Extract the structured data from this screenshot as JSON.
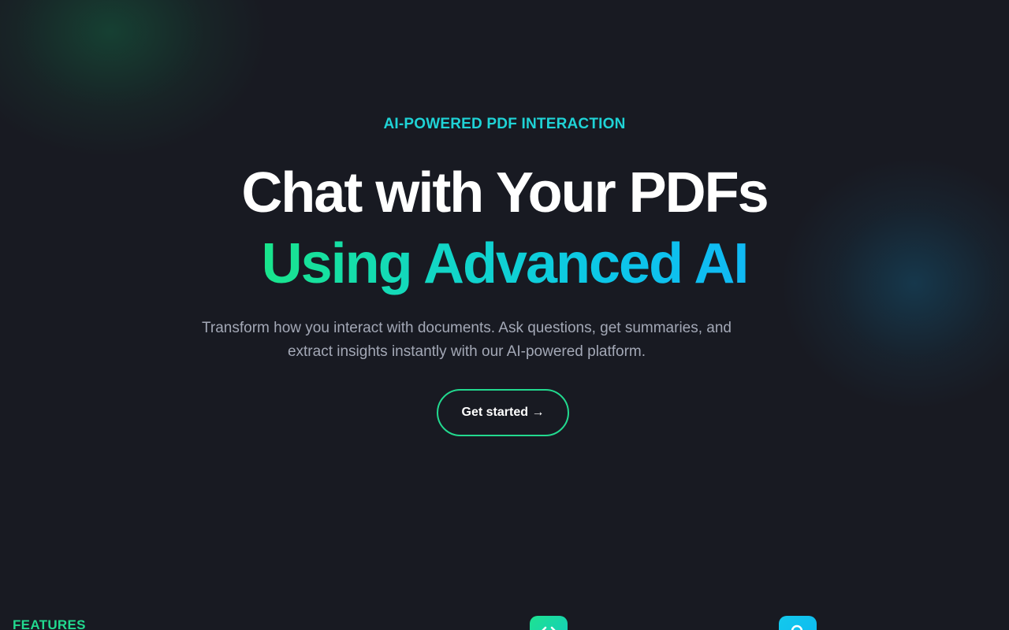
{
  "hero": {
    "eyebrow": "AI-POWERED PDF INTERACTION",
    "title_line1": "Chat with Your PDFs",
    "title_line2": "Using Advanced AI",
    "subtitle": "Transform how you interact with documents. Ask questions, get summaries, and extract insights instantly with our AI-powered platform.",
    "cta_label": "Get started →"
  },
  "features": {
    "section_label": "FEATURES",
    "icons": [
      "code-icon",
      "search-icon"
    ]
  },
  "colors": {
    "background": "#181a22",
    "accent_green": "#22d98f",
    "accent_cyan": "#1fd3d6",
    "accent_blue": "#10b9f4",
    "text_primary": "#ffffff",
    "text_secondary": "#a3a8b6"
  }
}
